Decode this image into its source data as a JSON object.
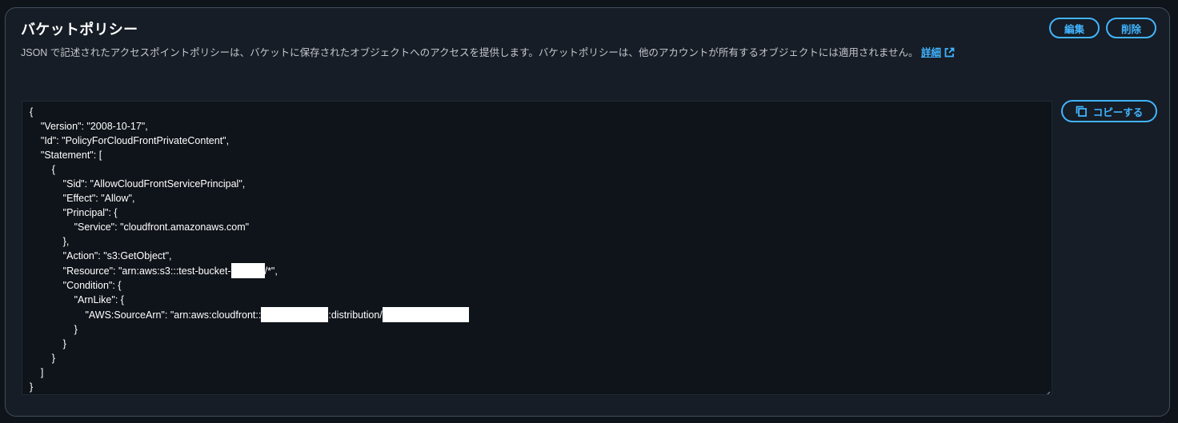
{
  "section": {
    "title": "バケットポリシー",
    "description": "JSON で記述されたアクセスポイントポリシーは、バケットに保存されたオブジェクトへのアクセスを提供します。バケットポリシーは、他のアカウントが所有するオブジェクトには適用されません。",
    "learn_more": "詳細"
  },
  "buttons": {
    "edit": "編集",
    "delete": "削除",
    "copy": "コピーする"
  },
  "icons": {
    "external_link": "external-link-icon",
    "copy": "copy-icon",
    "resize": "resize-handle-icon"
  },
  "colors": {
    "accent": "#42b4ff",
    "panel_bg": "#161d26",
    "page_bg": "#0f141a",
    "border": "#414d5c"
  },
  "policy": {
    "open_brace": "{",
    "version": "    \"Version\": \"2008-10-17\",",
    "id": "    \"Id\": \"PolicyForCloudFrontPrivateContent\",",
    "statement_open": "    \"Statement\": [",
    "stmt_brace_open": "        {",
    "sid": "            \"Sid\": \"AllowCloudFrontServicePrincipal\",",
    "effect": "            \"Effect\": \"Allow\",",
    "principal_open": "            \"Principal\": {",
    "service": "                \"Service\": \"cloudfront.amazonaws.com\"",
    "principal_close": "            },",
    "action": "            \"Action\": \"s3:GetObject\",",
    "resource_prefix": "            \"Resource\": \"arn:aws:s3:::test-bucket-",
    "resource_suffix": "/*\",",
    "condition_open": "            \"Condition\": {",
    "arnlike_open": "                \"ArnLike\": {",
    "sourcearn_prefix": "                    \"AWS:SourceArn\": \"arn:aws:cloudfront::",
    "sourcearn_middle": ":distribution/",
    "arnlike_close": "                }",
    "condition_close": "            }",
    "stmt_brace_close": "        }",
    "statement_close": "    ]",
    "close_brace": "}"
  }
}
